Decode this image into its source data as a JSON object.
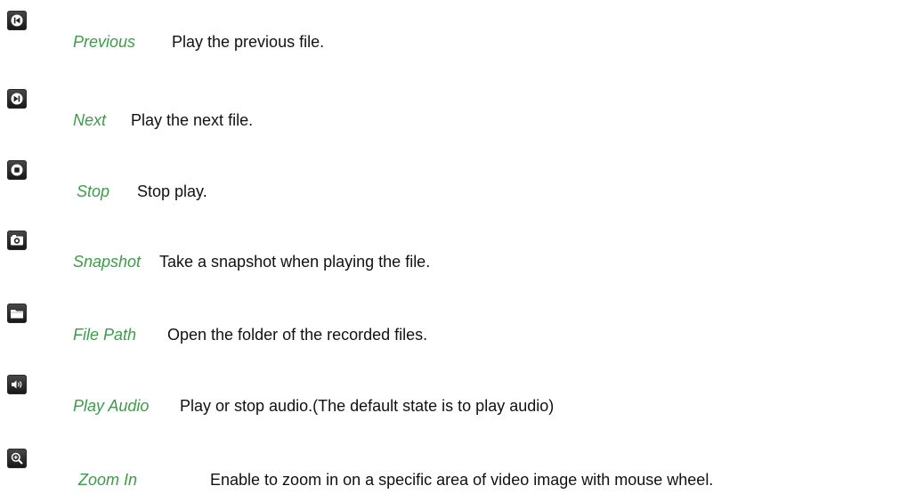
{
  "items": [
    {
      "icon": "previous-icon",
      "name": "Previous",
      "description": "Play the previous file."
    },
    {
      "icon": "next-icon",
      "name": "Next",
      "description": "Play the next file."
    },
    {
      "icon": "stop-icon",
      "name": "Stop",
      "description": "Stop play."
    },
    {
      "icon": "camera-icon",
      "name": "Snapshot",
      "description": "Take a snapshot when playing the file."
    },
    {
      "icon": "folder-icon",
      "name": "File Path",
      "description": "Open the folder of the recorded files."
    },
    {
      "icon": "speaker-icon",
      "name": "Play Audio",
      "description": "Play or stop audio.(The default state is to play audio)"
    },
    {
      "icon": "zoom-in-icon",
      "name": "Zoom In",
      "description": "Enable to zoom in on a specific area of video image with mouse wheel."
    }
  ],
  "colors": {
    "name_text": "#3f9a4c",
    "description_text": "#111111",
    "icon_background": "#2a2a2a"
  }
}
